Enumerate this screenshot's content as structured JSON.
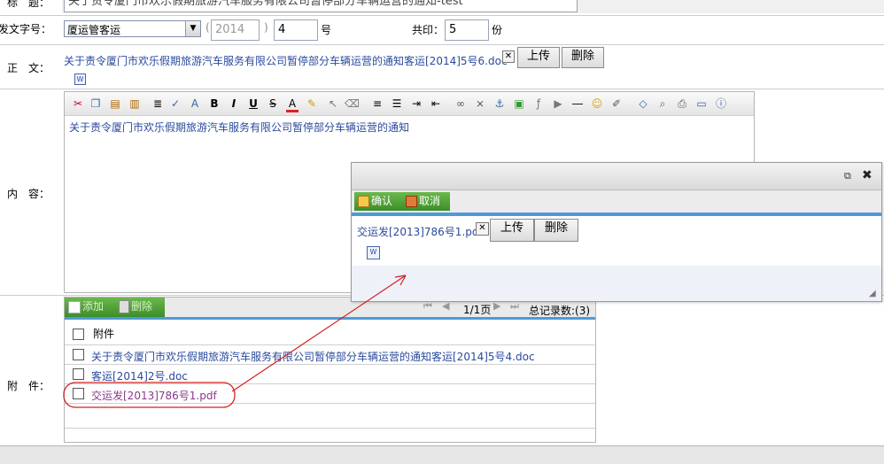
{
  "form": {
    "title_label": "标　题：",
    "title_value": "关于责令厦门市欢乐假期旅游汽车服务有限公司暂停部分车辆运营的通知-test",
    "docno_label": "发文字号：",
    "docno_select": "厦运管客运",
    "docno_paren_open": "(",
    "docno_year": "2014",
    "docno_paren_close": ")",
    "docno_number": "4",
    "docno_suffix": "号",
    "copies_label": "共印：",
    "copies_value": "5",
    "copies_suffix": "份",
    "body_label": "正　文：",
    "body_file": "关于责令厦门市欢乐假期旅游汽车服务有限公司暂停部分车辆运营的通知客运[2014]5号6.doc",
    "upload_label": "上传",
    "delete_label": "删除",
    "content_label": "内　容：",
    "content_text": "关于责令厦门市欢乐假期旅游汽车服务有限公司暂停部分车辆运营的通知",
    "attach_label": "附　件："
  },
  "toolbar_icons": [
    "cut-icon",
    "copy-icon",
    "paste-icon",
    "paste-text-icon",
    "format-icon",
    "spellcheck-icon",
    "font-size-icon",
    "bold-icon",
    "italic-icon",
    "underline-icon",
    "strike-icon",
    "font-color-icon",
    "highlight-icon",
    "select-icon",
    "eraser-icon",
    "align-left-icon",
    "list-icon",
    "indent-icon",
    "outdent-icon",
    "link-icon",
    "unlink-icon",
    "anchor-icon",
    "image-icon",
    "flash-icon",
    "media-icon",
    "hr-icon",
    "emoticon-icon",
    "edit-icon",
    "source-icon",
    "preview-icon",
    "print-icon",
    "fullscreen-icon",
    "about-icon"
  ],
  "attachments": {
    "add_label": "添加",
    "delete_label": "删除",
    "pager": "1/1页",
    "total": "总记录数:(3)",
    "header": "附件",
    "rows": [
      "关于责令厦门市欢乐假期旅游汽车服务有限公司暂停部分车辆运营的通知客运[2014]5号4.doc",
      "客运[2014]2号.doc",
      "交运发[2013]786号1.pdf"
    ]
  },
  "popup": {
    "confirm_label": "确认",
    "cancel_label": "取消",
    "file": "交运发[2013]786号1.pdf",
    "upload_label": "上传",
    "delete_label": "删除"
  },
  "colors": {
    "link": "#2a4a9c",
    "annotation": "#d42020",
    "accent_bar": "#4f9ad6"
  }
}
